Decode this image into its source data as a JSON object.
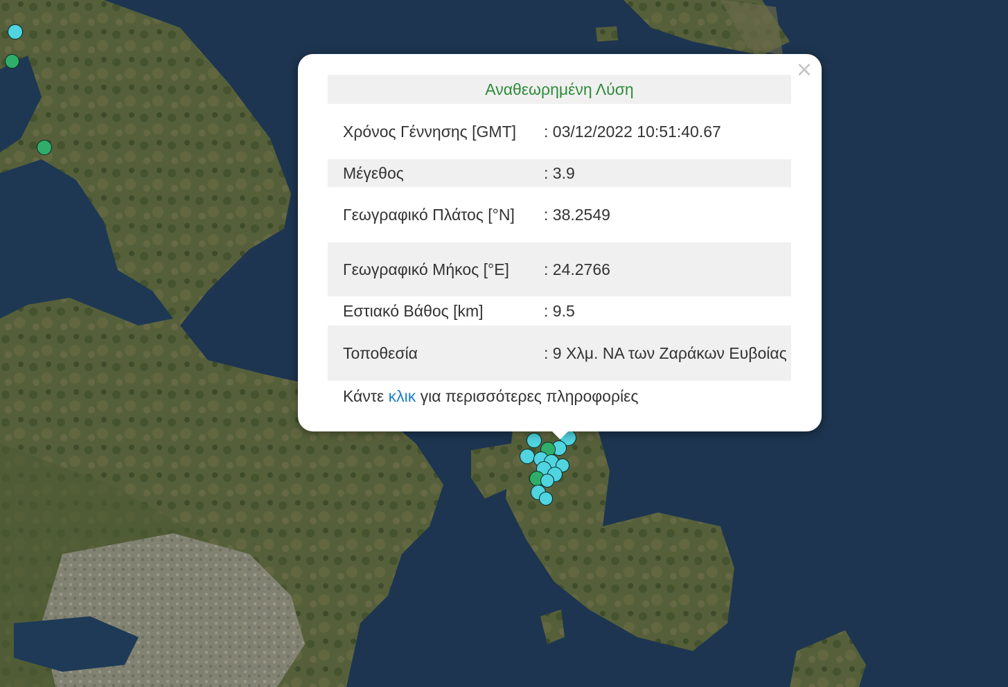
{
  "popup": {
    "close_symbol": "×",
    "header": "Αναθεωρημένη Λύση",
    "rows": [
      {
        "label": "Χρόνος Γέννησης [GMT]",
        "value": ": 03/12/2022 10:51:40.67"
      },
      {
        "label": "Μέγεθος",
        "value": ": 3.9"
      },
      {
        "label": "Γεωγραφικό Πλάτος [°N]",
        "value": ": 38.2549"
      },
      {
        "label": "Γεωγραφικό Μήκος [°E]",
        "value": ": 24.2766"
      },
      {
        "label": "Εστιακό Βάθος [km]",
        "value": ": 9.5"
      },
      {
        "label": "Τοποθεσία",
        "value": ": 9 Χλμ. ΝΑ των Ζαράκων Ευβοίας"
      }
    ],
    "footer_prefix": "Κάντε ",
    "footer_link": "κλικ",
    "footer_suffix": " για περισσότερες πληροφορίες"
  },
  "colors": {
    "sea": "#1d3550",
    "land": "#4f5a35",
    "marker_cyan": "#4fd4e0",
    "marker_green": "#2fae6a",
    "header_text": "#2e8b3a",
    "link": "#1a7fc8"
  }
}
